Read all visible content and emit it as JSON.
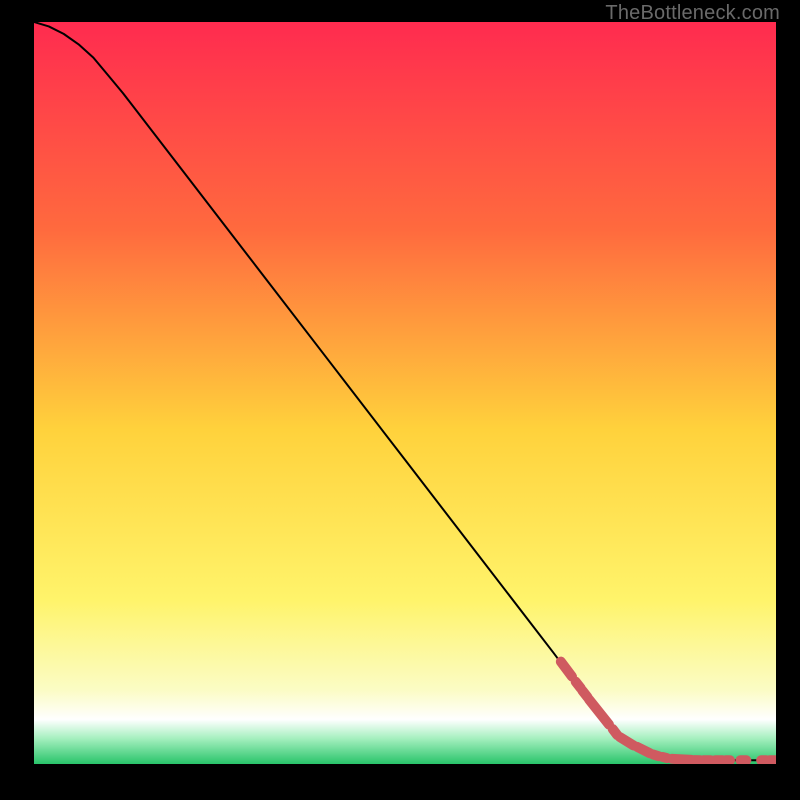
{
  "attribution": "TheBottleneck.com",
  "colors": {
    "bg": "#000000",
    "curve": "#000000",
    "marker": "#cf5a60",
    "attribution": "#6a6a6a",
    "grad_top": "#ff2b4f",
    "grad_upper_mid": "#ff8b3a",
    "grad_mid": "#ffd23c",
    "grad_lower_mid": "#fff46b",
    "grad_pale": "#f6fca8",
    "grad_white": "#ffffff",
    "grad_mint": "#7de9a4",
    "grad_green": "#29c46a"
  },
  "chart_data": {
    "type": "line",
    "title": "",
    "xlabel": "",
    "ylabel": "",
    "xlim": [
      0,
      100
    ],
    "ylim": [
      0,
      100
    ],
    "series": [
      {
        "name": "curve",
        "x": [
          0,
          2,
          4,
          6,
          8,
          10,
          12,
          14,
          20,
          30,
          40,
          50,
          60,
          70,
          76,
          80,
          84,
          86,
          88,
          90,
          92,
          94,
          96,
          98,
          100
        ],
        "y": [
          100,
          99.4,
          98.4,
          97.0,
          95.2,
          92.8,
          90.4,
          87.8,
          80.0,
          67.0,
          54.0,
          41.0,
          28.0,
          15.0,
          7.0,
          3.2,
          1.2,
          0.75,
          0.5,
          0.5,
          0.5,
          0.5,
          0.5,
          0.5,
          0.5
        ]
      }
    ],
    "markers": {
      "name": "segments",
      "positions": [
        {
          "x0": 71.0,
          "y0": 13.8,
          "x1": 72.5,
          "y1": 11.8
        },
        {
          "x0": 73.0,
          "y0": 11.1,
          "x1": 73.7,
          "y1": 10.2
        },
        {
          "x0": 73.9,
          "y0": 9.9,
          "x1": 74.6,
          "y1": 9.0
        },
        {
          "x0": 74.8,
          "y0": 8.7,
          "x1": 77.5,
          "y1": 5.3
        },
        {
          "x0": 78.0,
          "y0": 4.7,
          "x1": 78.6,
          "y1": 3.9
        },
        {
          "x0": 79.0,
          "y0": 3.6,
          "x1": 80.8,
          "y1": 2.5
        },
        {
          "x0": 81.3,
          "y0": 2.3,
          "x1": 83.0,
          "y1": 1.45
        },
        {
          "x0": 83.4,
          "y0": 1.3,
          "x1": 84.2,
          "y1": 1.05
        },
        {
          "x0": 84.7,
          "y0": 0.95,
          "x1": 85.3,
          "y1": 0.8
        },
        {
          "x0": 86.0,
          "y0": 0.7,
          "x1": 88.6,
          "y1": 0.55
        },
        {
          "x0": 89.0,
          "y0": 0.52,
          "x1": 89.8,
          "y1": 0.5
        },
        {
          "x0": 90.2,
          "y0": 0.5,
          "x1": 91.2,
          "y1": 0.5
        },
        {
          "x0": 91.8,
          "y0": 0.5,
          "x1": 92.8,
          "y1": 0.5
        },
        {
          "x0": 93.2,
          "y0": 0.5,
          "x1": 93.8,
          "y1": 0.5
        },
        {
          "x0": 95.2,
          "y0": 0.5,
          "x1": 96.0,
          "y1": 0.5
        },
        {
          "x0": 98.0,
          "y0": 0.5,
          "x1": 98.7,
          "y1": 0.5
        },
        {
          "x0": 99.1,
          "y0": 0.5,
          "x1": 99.9,
          "y1": 0.5
        }
      ]
    }
  }
}
